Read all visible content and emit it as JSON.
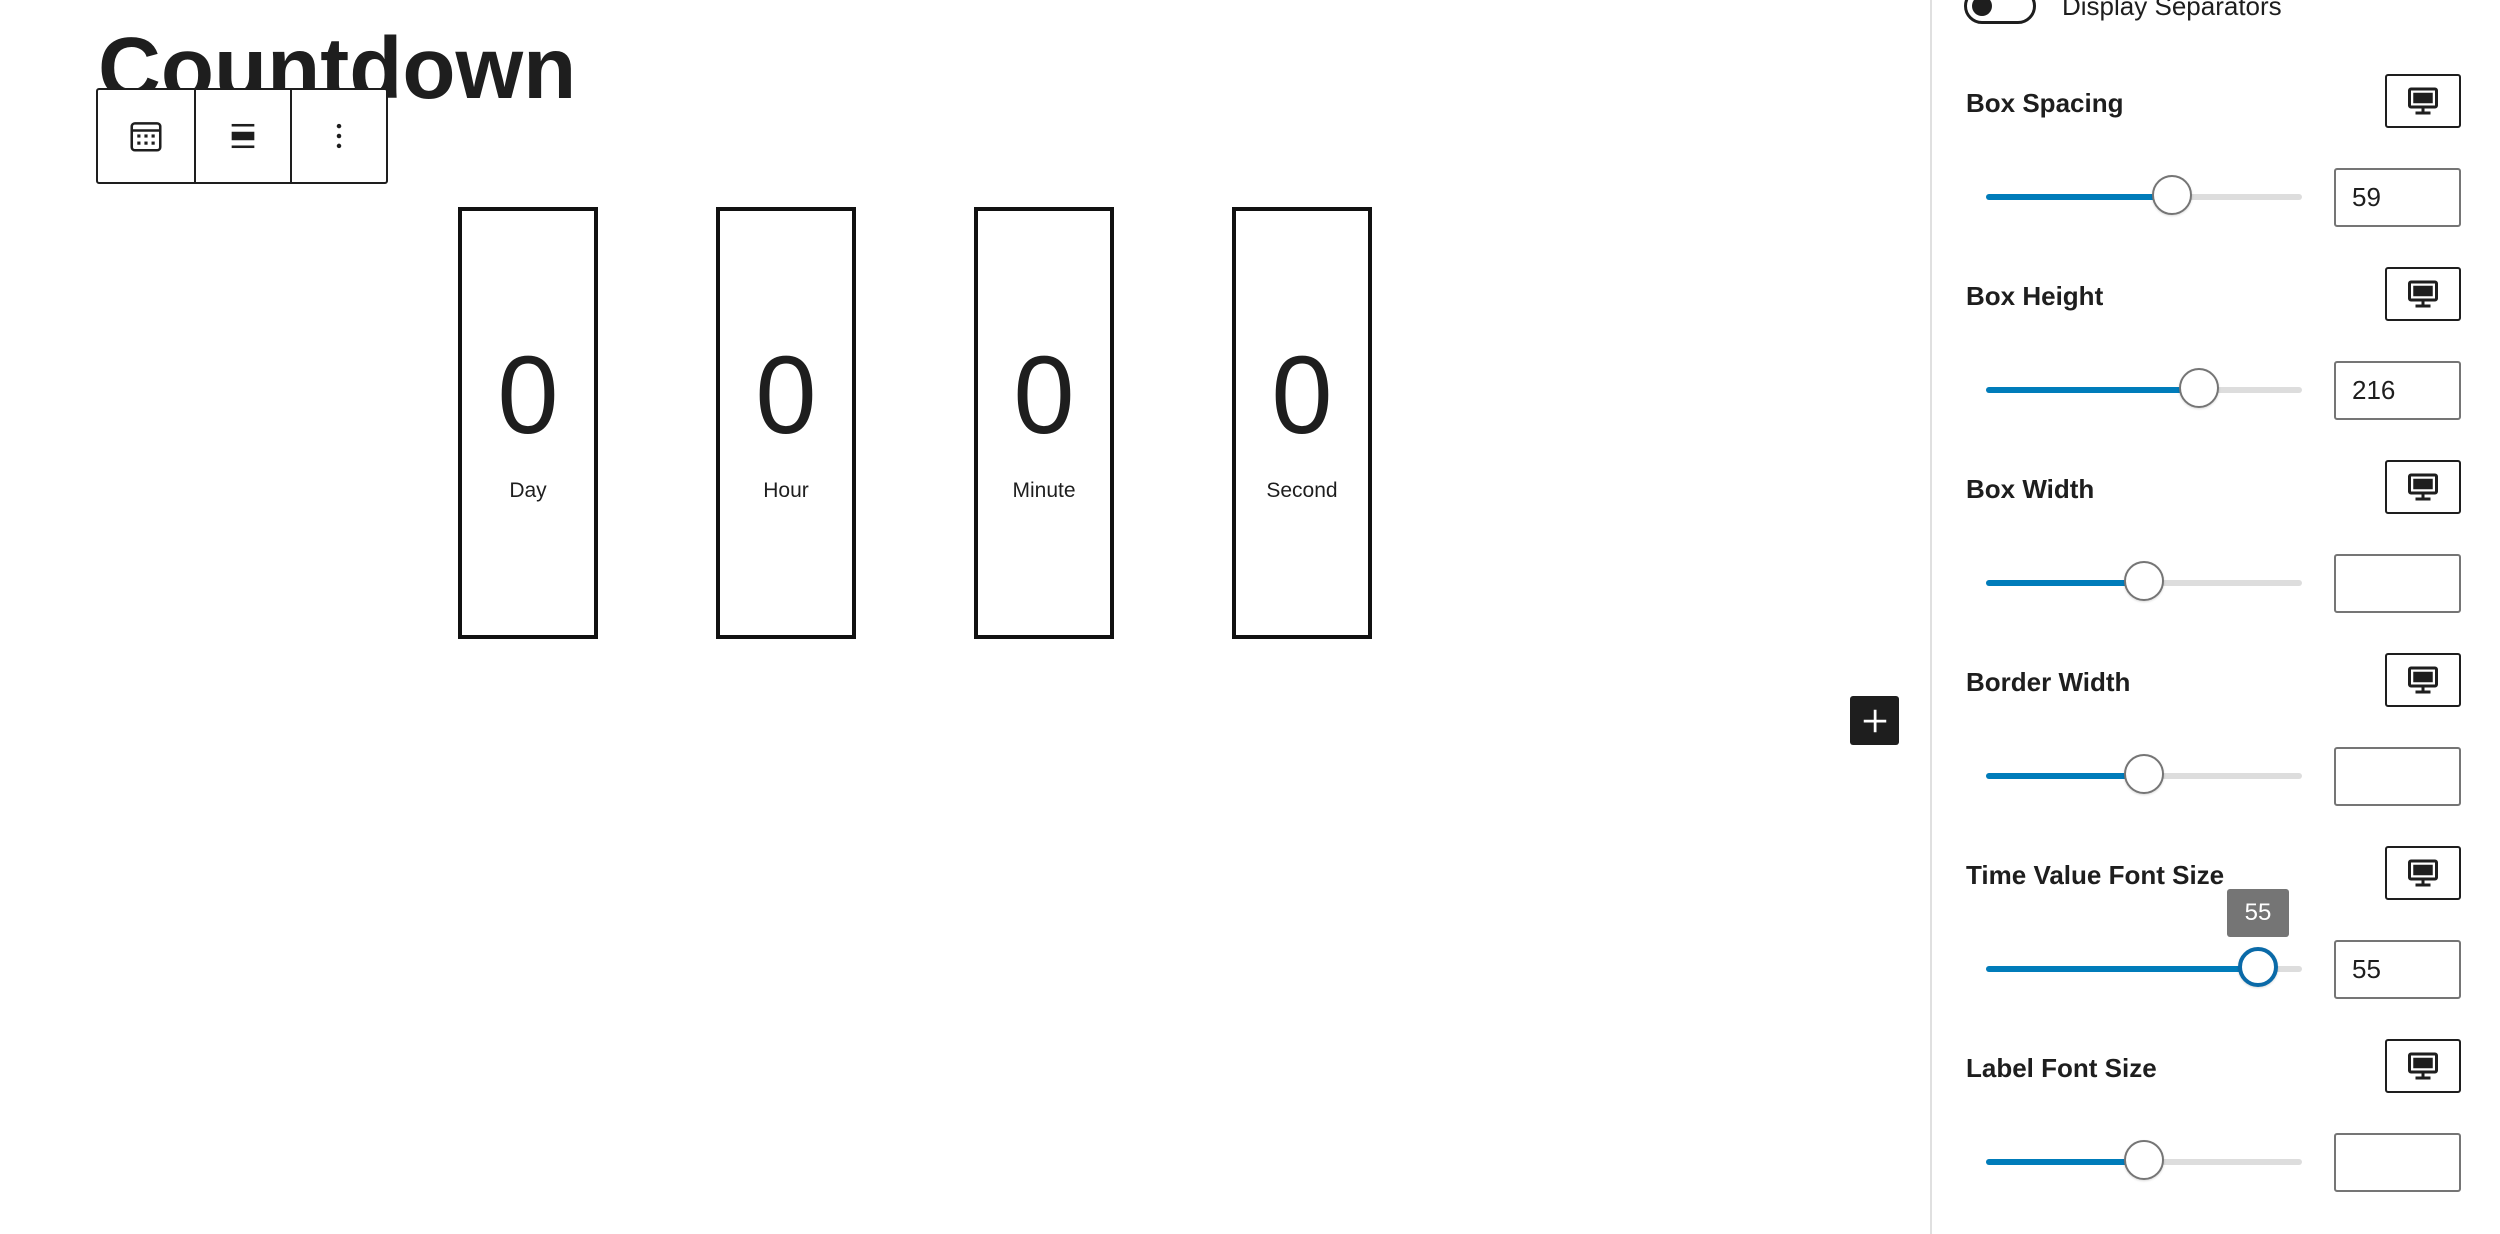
{
  "page": {
    "title": "Countdown"
  },
  "toolbar": {
    "buttons": [
      {
        "name": "block-type-calendar",
        "icon": "calendar-icon"
      },
      {
        "name": "align",
        "icon": "align-center-icon"
      },
      {
        "name": "options",
        "icon": "vertical-ellipsis-icon"
      }
    ]
  },
  "countdown": {
    "units": [
      {
        "value": "0",
        "label": "Day"
      },
      {
        "value": "0",
        "label": "Hour"
      },
      {
        "value": "0",
        "label": "Minute"
      },
      {
        "value": "0",
        "label": "Second"
      }
    ]
  },
  "inserter": {
    "icon": "plus-icon"
  },
  "sidebar": {
    "separators_toggle": {
      "label": "Display Separators",
      "checked": false
    },
    "device_icon": "desktop-icon",
    "controls": [
      {
        "label": "Box Spacing",
        "value": "59",
        "fraction": 0.59,
        "tooltip": ""
      },
      {
        "label": "Box Height",
        "value": "216",
        "fraction": 0.675,
        "tooltip": ""
      },
      {
        "label": "Box Width",
        "value": "",
        "fraction": 0.5,
        "tooltip": ""
      },
      {
        "label": "Border Width",
        "value": "",
        "fraction": 0.5,
        "tooltip": ""
      },
      {
        "label": "Time Value Font Size",
        "value": "55",
        "fraction": 0.86,
        "tooltip": "55"
      },
      {
        "label": "Label Font Size",
        "value": "",
        "fraction": 0.5,
        "tooltip": ""
      }
    ]
  },
  "colors": {
    "accent": "#007cba",
    "text": "#1e1e1e",
    "track": "#dddddd",
    "tooltip": "#757575"
  }
}
